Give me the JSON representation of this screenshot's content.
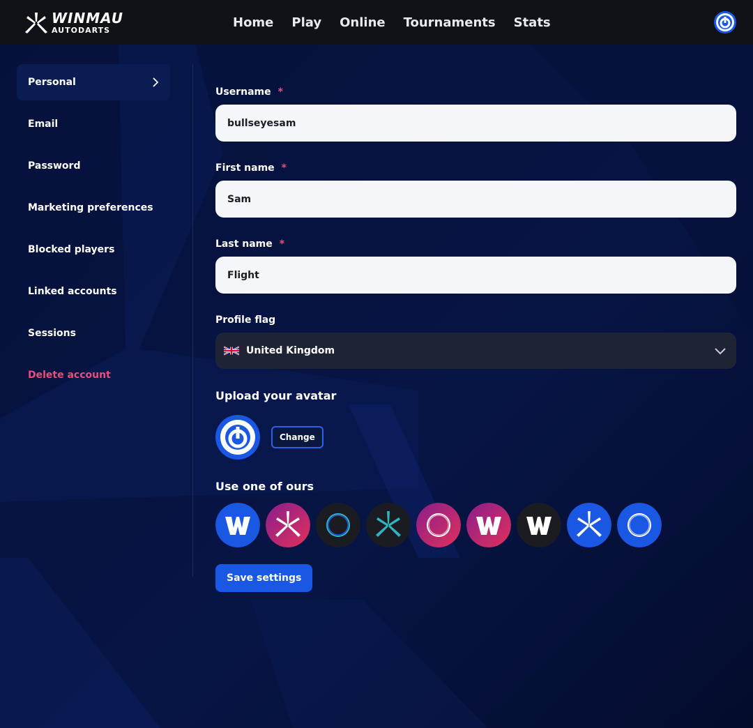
{
  "header": {
    "logo_brand": "WINMAU",
    "logo_sub": "AUTODARTS",
    "nav": [
      "Home",
      "Play",
      "Online",
      "Tournaments",
      "Stats"
    ]
  },
  "sidebar": {
    "items": [
      {
        "label": "Personal",
        "active": true
      },
      {
        "label": "Email"
      },
      {
        "label": "Password"
      },
      {
        "label": "Marketing preferences"
      },
      {
        "label": "Blocked players"
      },
      {
        "label": "Linked accounts"
      },
      {
        "label": "Sessions"
      },
      {
        "label": "Delete account",
        "danger": true
      }
    ]
  },
  "form": {
    "username": {
      "label": "Username",
      "required": "*",
      "value": "bullseyesam"
    },
    "first_name": {
      "label": "First name",
      "required": "*",
      "value": "Sam"
    },
    "last_name": {
      "label": "Last name",
      "required": "*",
      "value": "Flight"
    },
    "profile_flag": {
      "label": "Profile flag",
      "value": "United Kingdom",
      "flag_icon": "uk-flag-icon"
    },
    "upload_avatar": {
      "title": "Upload your avatar",
      "change_label": "Change"
    },
    "presets": {
      "title": "Use one of ours"
    },
    "save_label": "Save settings"
  },
  "colors": {
    "accent": "#1a58e4",
    "danger": "#e8507a",
    "topbar": "#111217",
    "background": "#030c2a"
  }
}
